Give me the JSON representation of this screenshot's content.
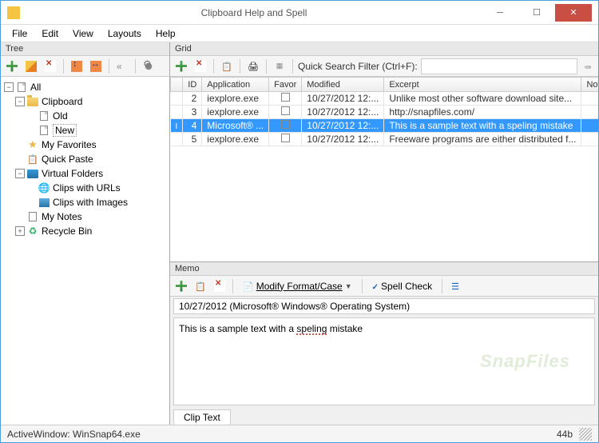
{
  "window": {
    "title": "Clipboard Help and Spell"
  },
  "menubar": [
    "File",
    "Edit",
    "View",
    "Layouts",
    "Help"
  ],
  "tree": {
    "title": "Tree",
    "nodes": {
      "all": "All",
      "clipboard": "Clipboard",
      "old": "Old",
      "new": "New",
      "favorites": "My Favorites",
      "quickpaste": "Quick Paste",
      "vfolders": "Virtual Folders",
      "clips_urls": "Clips with URLs",
      "clips_images": "Clips with Images",
      "notes": "My Notes",
      "recycle": "Recycle Bin"
    }
  },
  "grid": {
    "title": "Grid",
    "search_label": "Quick Search Filter (Ctrl+F):",
    "search_value": "",
    "columns": {
      "marker": "",
      "id": "ID",
      "application": "Application",
      "favor": "Favor",
      "modified": "Modified",
      "excerpt": "Excerpt",
      "notes": "Notes"
    },
    "rows": [
      {
        "id": "2",
        "application": "iexplore.exe",
        "favor": false,
        "modified": "10/27/2012 12:...",
        "excerpt": "Unlike most other software download site...",
        "notes": "",
        "selected": false
      },
      {
        "id": "3",
        "application": "iexplore.exe",
        "favor": false,
        "modified": "10/27/2012 12:...",
        "excerpt": "http://snapfiles.com/",
        "notes": "",
        "selected": false
      },
      {
        "id": "4",
        "application": "Microsoft® ...",
        "favor": false,
        "modified": "10/27/2012 12:...",
        "excerpt": "This is a sample text with a speling mistake",
        "notes": "",
        "selected": true
      },
      {
        "id": "5",
        "application": "iexplore.exe",
        "favor": false,
        "modified": "10/27/2012 12:...",
        "excerpt": "Freeware programs are either distributed f...",
        "notes": "",
        "selected": false
      }
    ]
  },
  "memo": {
    "title": "Memo",
    "modify_label": "Modify Format/Case",
    "spell_label": "Spell Check",
    "header": "10/27/2012 (Microsoft® Windows® Operating System)",
    "text_before": "This is a sample text with a ",
    "text_err": "speling",
    "text_after": " mistake",
    "watermark": "SnapFiles",
    "tab": "Clip Text"
  },
  "statusbar": {
    "left": "ActiveWindow: WinSnap64.exe",
    "right": "44b"
  }
}
